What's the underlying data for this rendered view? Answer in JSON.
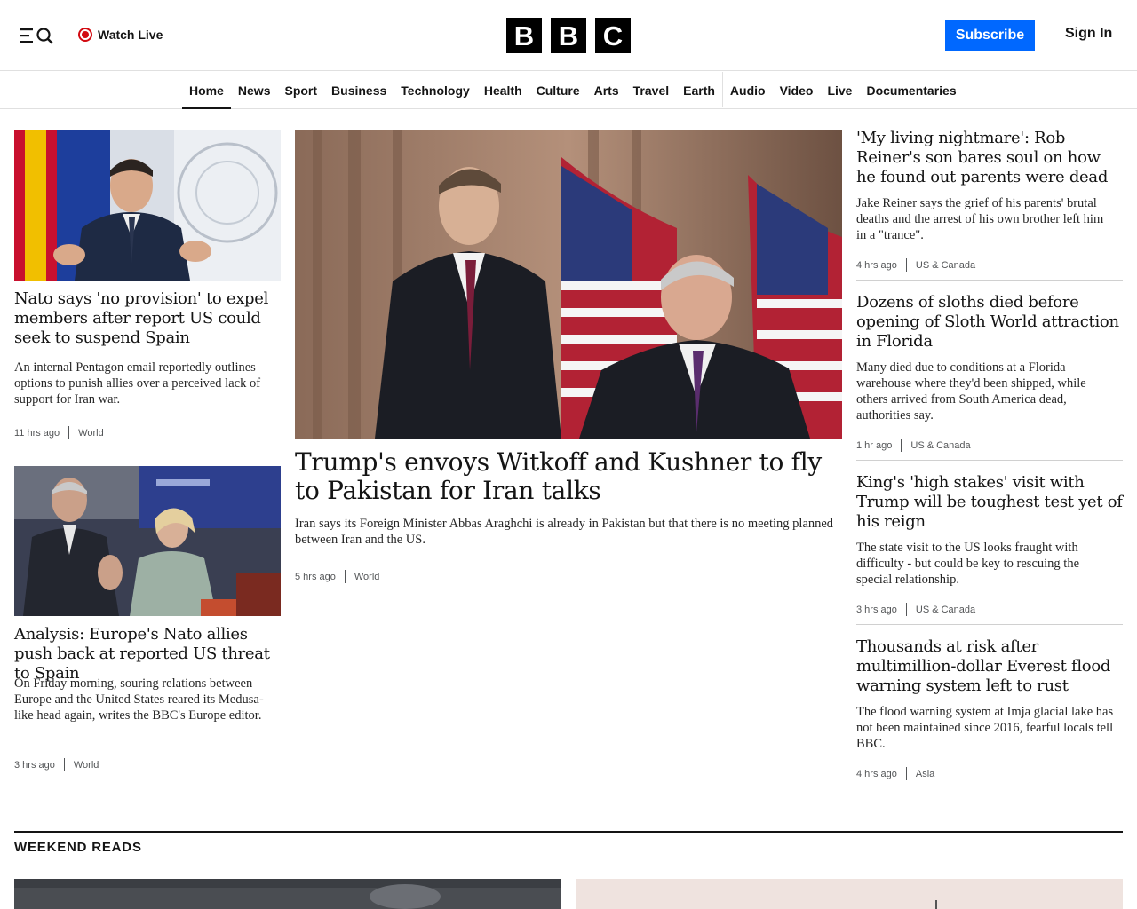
{
  "header": {
    "watch_live": "Watch Live",
    "logo_letters": [
      "B",
      "B",
      "C"
    ],
    "subscribe": "Subscribe",
    "sign_in": "Sign In",
    "accent_color": "#0068ff",
    "live_color": "#d20a11"
  },
  "nav": {
    "items": [
      "Home",
      "News",
      "Sport",
      "Business",
      "Technology",
      "Health",
      "Culture",
      "Arts",
      "Travel",
      "Earth",
      "Audio",
      "Video",
      "Live",
      "Documentaries"
    ],
    "active": "Home"
  },
  "left_column": [
    {
      "headline": "Nato says 'no provision' to expel members after report US could seek to suspend Spain",
      "summary": "An internal Pentagon email reportedly outlines options to punish allies over a perceived lack of support for Iran war.",
      "time": "11 hrs ago",
      "section": "World"
    },
    {
      "headline": "Analysis: Europe's Nato allies push back at reported US threat to Spain",
      "summary": "On Friday morning, souring relations between Europe and the United States reared its Medusa-like head again, writes the BBC's Europe editor.",
      "time": "3 hrs ago",
      "section": "World"
    }
  ],
  "lead": {
    "headline": "Trump's envoys Witkoff and Kushner to fly to Pakistan for Iran talks",
    "summary": "Iran says its Foreign Minister Abbas Araghchi is already in Pakistan but that there is no meeting planned between Iran and the US.",
    "time": "5 hrs ago",
    "section": "World"
  },
  "right_column": [
    {
      "headline": "'My living nightmare': Rob Reiner's son bares soul on how he found out parents were dead",
      "summary": "Jake Reiner says the grief of his parents' brutal deaths and the arrest of his own brother left him in a \"trance\".",
      "time": "4 hrs ago",
      "section": "US & Canada"
    },
    {
      "headline": "Dozens of sloths died before opening of Sloth World attraction in Florida",
      "summary": "Many died due to conditions at a Florida warehouse where they'd been shipped, while others arrived from South America dead, authorities say.",
      "time": "1 hr ago",
      "section": "US & Canada"
    },
    {
      "headline": "King's 'high stakes' visit with Trump will be toughest test yet of his reign",
      "summary": "The state visit to the US looks fraught with difficulty - but could be key to rescuing the special relationship.",
      "time": "3 hrs ago",
      "section": "US & Canada"
    },
    {
      "headline": "Thousands at risk after multimillion-dollar Everest flood warning system left to rust",
      "summary": "The flood warning system at Imja glacial lake has not been maintained since 2016, fearful locals tell BBC.",
      "time": "4 hrs ago",
      "section": "Asia"
    }
  ],
  "weekend_reads": {
    "title": "WEEKEND READS"
  }
}
